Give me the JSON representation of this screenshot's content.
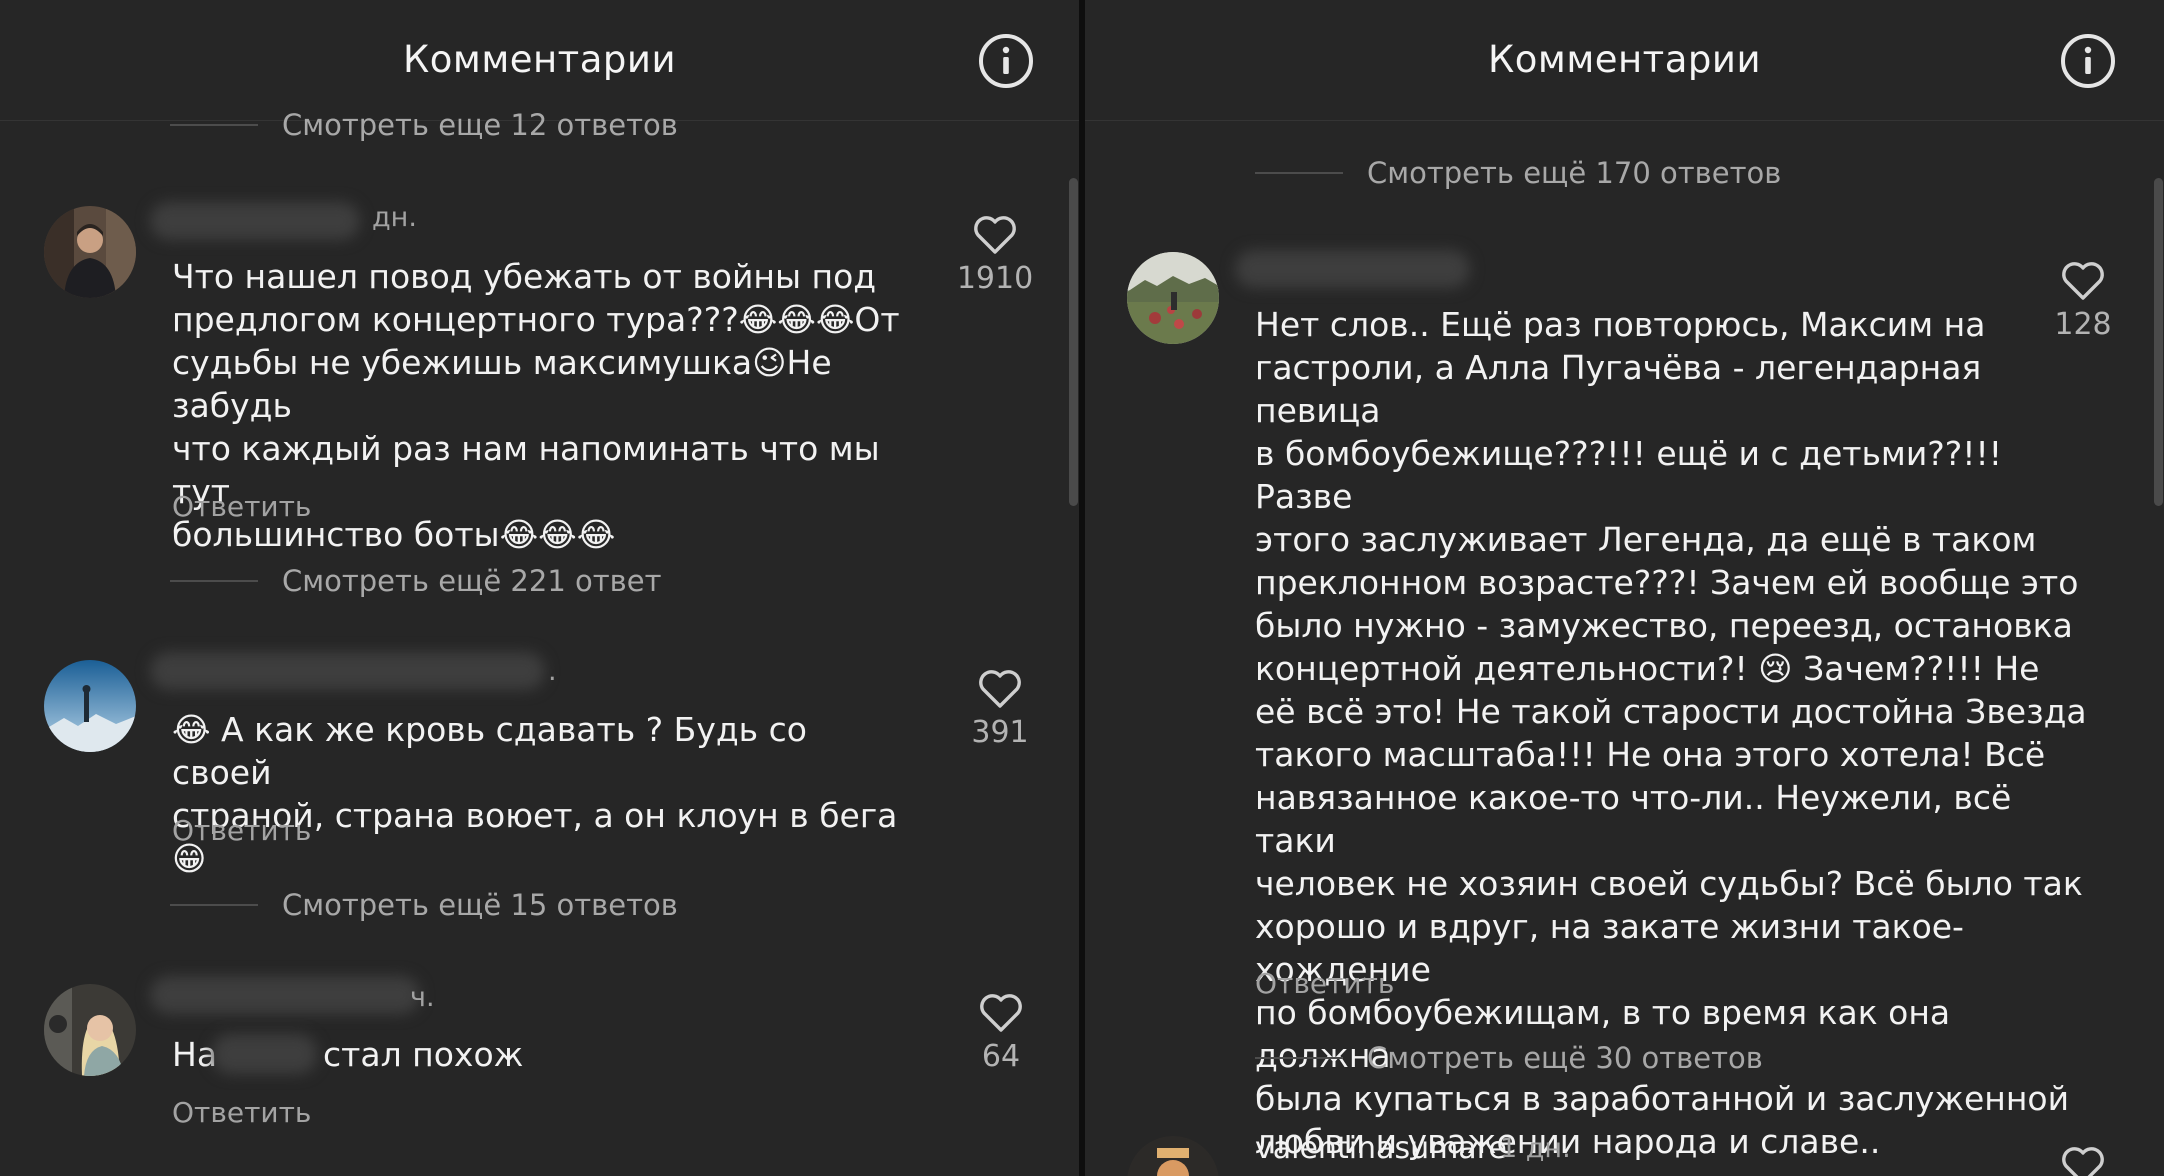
{
  "left": {
    "header_title": "Комментарии",
    "top_more": "Смотреть еще 12 ответов",
    "comments": [
      {
        "meta": "дн.",
        "text": "Что нашел повод убежать от войны под\nпредлогом концертного тура???😂😂😂От\nсудьбы не убежишь максимушка😉Не забудь\nчто каждый раз нам напоминать что мы тут\nбольшинство боты😂😂😂",
        "reply": "Ответить",
        "likes": "1910",
        "more": "Смотреть ещё 221 ответ"
      },
      {
        "meta": ".",
        "text": "😂 А как же кровь сдавать ? Будь со своей\nстраной, страна воюет, а он клоун в бега 😁",
        "reply": "Ответить",
        "likes": "391",
        "more": "Смотреть ещё 15 ответов"
      },
      {
        "meta": "ч.",
        "text_start": "На",
        "text_end": "стал похож",
        "reply": "Ответить",
        "likes": "64"
      }
    ]
  },
  "right": {
    "header_title": "Комментарии",
    "top_more": "Смотреть ещё 170 ответов",
    "comment": {
      "text": "Нет слов.. Ещё раз повторюсь, Максим на\nгастроли, а Алла Пугачёва - легендарная певица\nв бомбоубежище???!!! ещё и с детьми??!!! Разве\nэтого заслуживает Легенда, да ещё в таком\nпреклонном возрасте???! Зачем ей вообще это\nбыло нужно - замужество, переезд, остановка\nконцертной деятельности?! 😢 Зачем??!!! Не\nеё всё это! Не такой старости достойна Звезда\nтакого масштаба!!! Не она этого хотела! Всё\nнавязанное какое-то что-ли.. Неужели, всё таки\nчеловек не хозяин своей судьбы? Всё было так\nхорошо и вдруг, на закате жизни такое- хождение\nпо бомбоубежищам, в то время как она должна\nбыла купаться в заработанной и заслуженной\nлюбви и уважении народа и славе..",
      "reply": "Ответить",
      "likes": "128",
      "more": "Смотреть ещё 30 ответов"
    },
    "next_comment": {
      "username": "valentinasumare",
      "time": "1 дн."
    }
  },
  "colors": {
    "background": "#262626",
    "text": "#f2f2f2",
    "muted": "#a8a8a8"
  },
  "icons": [
    "info-icon",
    "heart-icon"
  ]
}
